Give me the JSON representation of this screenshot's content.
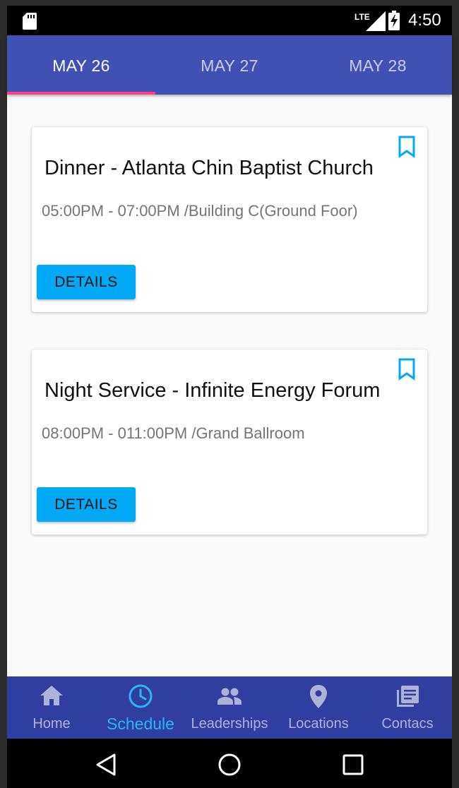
{
  "status_bar": {
    "network": "LTE",
    "time": "4:50"
  },
  "tabs": [
    {
      "label": "MAY 26",
      "active": true
    },
    {
      "label": "MAY 27",
      "active": false
    },
    {
      "label": "MAY 28",
      "active": false
    }
  ],
  "events": [
    {
      "title": "Dinner - Atlanta Chin Baptist Church",
      "meta": "05:00PM - 07:00PM /Building C(Ground Foor)",
      "button_label": "DETAILS"
    },
    {
      "title": "Night Service - Infinite Energy Forum",
      "meta": "08:00PM - 011:00PM /Grand Ballroom",
      "button_label": "DETAILS"
    }
  ],
  "bottom_nav": [
    {
      "label": "Home",
      "icon": "home-icon",
      "active": false
    },
    {
      "label": "Schedule",
      "icon": "clock-icon",
      "active": true
    },
    {
      "label": "Leaderships",
      "icon": "people-icon",
      "active": false
    },
    {
      "label": "Locations",
      "icon": "location-pin-icon",
      "active": false
    },
    {
      "label": "Contacs",
      "icon": "library-books-icon",
      "active": false
    }
  ],
  "colors": {
    "app_bar": "#3f51b5",
    "tab_indicator": "#ff4081",
    "accent": "#03a9f4",
    "bottom_nav": "#303f9f",
    "nav_active": "#29b6f6"
  }
}
